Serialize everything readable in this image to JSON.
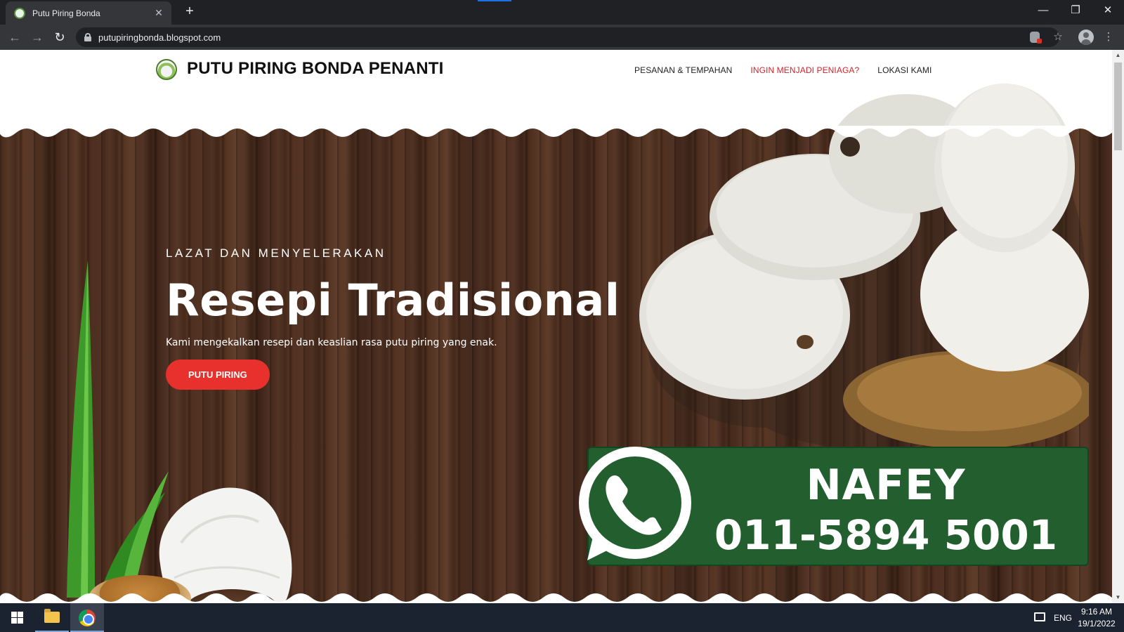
{
  "browser": {
    "tab_title": "Putu Piring Bonda",
    "url": "putupiringbonda.blogspot.com"
  },
  "site": {
    "title": "PUTU PIRING BONDA PENANTI",
    "menu": [
      {
        "label": "PESANAN & TEMPAHAN"
      },
      {
        "label": "INGIN MENJADI PENIAGA?"
      },
      {
        "label": "LOKASI KAMI"
      }
    ]
  },
  "hero": {
    "eyebrow": "LAZAT DAN MENYELERAKAN",
    "title": "Resepi Tradisional",
    "description": "Kami mengekalkan resepi dan keaslian rasa putu piring yang enak.",
    "button_label": "PUTU PIRING"
  },
  "whatsapp_banner": {
    "name": "NAFEY",
    "phone": "011-5894 5001"
  },
  "taskbar": {
    "language": "ENG",
    "time": "9:16 AM",
    "date": "19/1/2022"
  },
  "colors": {
    "accent_red": "#e8312d",
    "menu_highlight": "#d2232a",
    "whatsapp_green": "#235e2f"
  }
}
